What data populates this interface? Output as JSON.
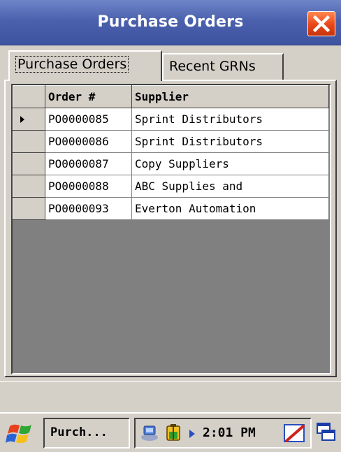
{
  "window": {
    "title": "Purchase Orders"
  },
  "tabs": [
    {
      "label": "Purchase Orders",
      "active": true
    },
    {
      "label": "Recent GRNs",
      "active": false
    }
  ],
  "grid": {
    "columns": [
      "Order #",
      "Supplier"
    ],
    "rows": [
      {
        "order": "PO0000085",
        "supplier": "Sprint Distributors",
        "current": true
      },
      {
        "order": "PO0000086",
        "supplier": "Sprint Distributors",
        "current": false
      },
      {
        "order": "PO0000087",
        "supplier": "Copy Suppliers",
        "current": false
      },
      {
        "order": "PO0000088",
        "supplier": "ABC Supplies and",
        "current": false
      },
      {
        "order": "PO0000093",
        "supplier": "Everton Automation",
        "current": false
      }
    ]
  },
  "taskbar": {
    "task_label": "Purch...",
    "clock": "2:01 PM",
    "start_icon": "windows-flag-icon",
    "tray_icons": [
      "network-icon",
      "battery-icon",
      "volume-arrow-icon",
      "input-panel-icon",
      "desktop-icon"
    ]
  },
  "colors": {
    "titlebar": "#4b61ad",
    "close": "#e8461a",
    "window_bg": "#d4d0c8",
    "grid_bg": "#808080"
  }
}
